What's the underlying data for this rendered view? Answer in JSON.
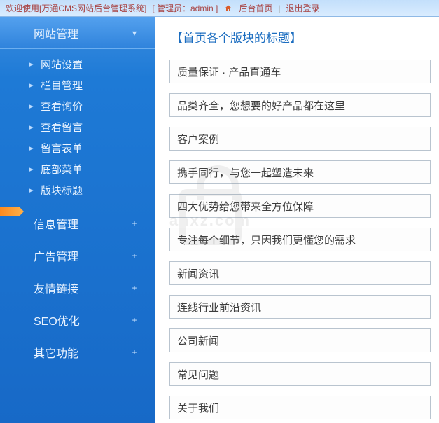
{
  "topbar": {
    "welcome": "欢迎使用[万通CMS网站后台管理系统]",
    "admin_label": "[ 管理员：admin ]",
    "link_home": "后台首页",
    "link_logout": "退出登录"
  },
  "sidebar": {
    "sections": [
      {
        "label": "网站管理",
        "expanded": true
      },
      {
        "label": "信息管理",
        "expanded": false
      },
      {
        "label": "广告管理",
        "expanded": false
      },
      {
        "label": "友情链接",
        "expanded": false
      },
      {
        "label": "SEO优化",
        "expanded": false
      },
      {
        "label": "其它功能",
        "expanded": false
      }
    ],
    "submenu": [
      "网站设置",
      "栏目管理",
      "查看询价",
      "查看留言",
      "留言表单",
      "底部菜单",
      "版块标题"
    ],
    "active_index": 6
  },
  "main": {
    "title": "【首页各个版块的标题】",
    "fields": [
      "质量保证 · 产品直通车",
      "品类齐全，您想要的好产品都在这里",
      "客户案例",
      "携手同行，与您一起塑造未来",
      "四大优势给您带来全方位保障",
      "专注每个细节，只因我们更懂您的需求",
      "新闻资讯",
      "连线行业前沿资讯",
      "公司新闻",
      "常见问题",
      "关于我们"
    ]
  },
  "watermark": {
    "text": "anxz.com"
  }
}
